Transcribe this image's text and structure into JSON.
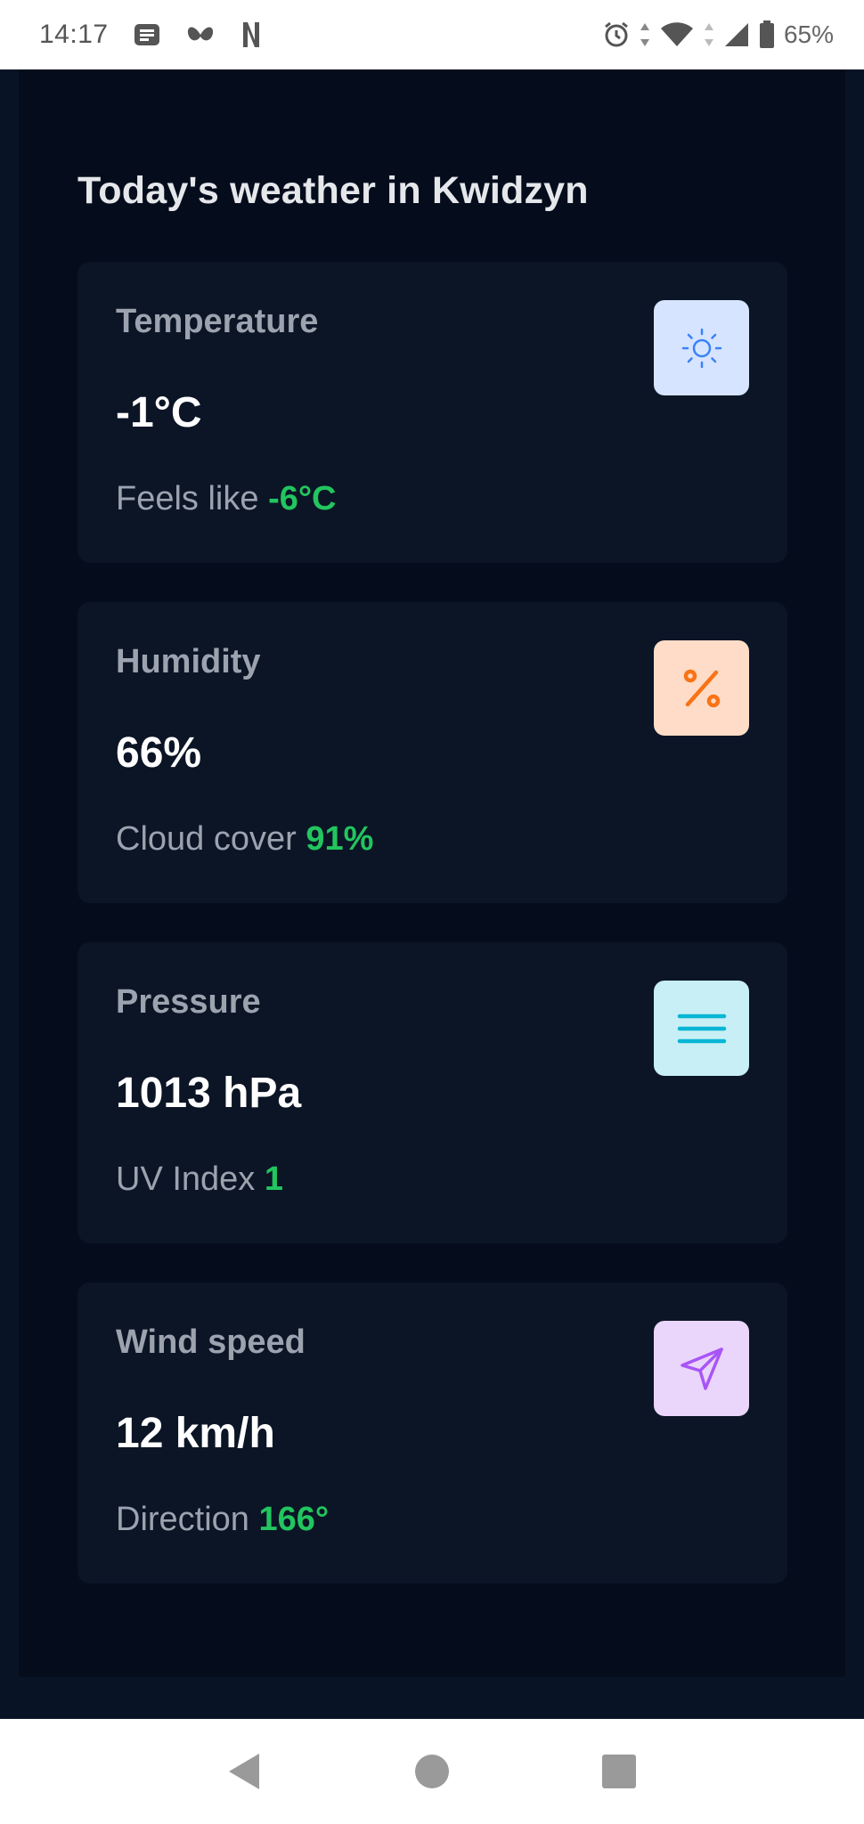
{
  "status_bar": {
    "time": "14:17",
    "notification_icons": [
      "message-icon",
      "butterfly-icon",
      "n-app-icon"
    ],
    "system_icons": [
      "alarm-icon",
      "wifi-icon",
      "signal-icon",
      "battery-icon"
    ],
    "battery": "65%"
  },
  "page": {
    "heading": "Today's weather in Kwidzyn"
  },
  "cards": [
    {
      "label": "Temperature",
      "value": "-1°C",
      "sub_label": "Feels like",
      "sub_value": "-6°C",
      "icon": "sun-icon",
      "icon_bg": "#d6e4ff",
      "icon_color": "#3b82f6"
    },
    {
      "label": "Humidity",
      "value": "66%",
      "sub_label": "Cloud cover",
      "sub_value": "91%",
      "icon": "percent-icon",
      "icon_bg": "#ffdcc7",
      "icon_color": "#f97316"
    },
    {
      "label": "Pressure",
      "value": "1013 hPa",
      "sub_label": "UV Index",
      "sub_value": "1",
      "icon": "menu-lines-icon",
      "icon_bg": "#c8eff5",
      "icon_color": "#06b6d4"
    },
    {
      "label": "Wind speed",
      "value": "12 km/h",
      "sub_label": "Direction",
      "sub_value": "166°",
      "icon": "send-icon",
      "icon_bg": "#ead5fb",
      "icon_color": "#a855f7"
    }
  ],
  "nav_bar": {
    "buttons": [
      "back-icon",
      "home-icon",
      "recents-icon"
    ]
  },
  "colors": {
    "accent_green": "#22c55e",
    "card_bg": "#0b1526",
    "panel_bg": "#050d1c"
  }
}
